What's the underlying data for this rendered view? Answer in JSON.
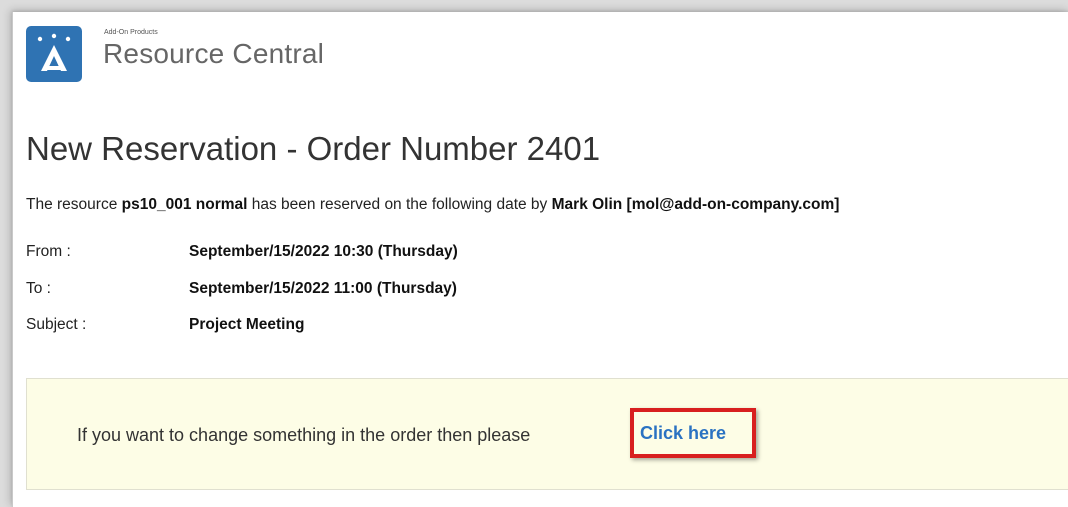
{
  "brand": {
    "small_text": "Add-On Products",
    "title": "Resource Central",
    "color": "#2f73b3"
  },
  "email": {
    "heading": "New Reservation - Order Number 2401",
    "sentence": {
      "prefix": "The resource ",
      "resource": "ps10_001 normal",
      "middle": " has been reserved on the following date by ",
      "person": "Mark Olin [mol@add-on-company.com]"
    },
    "details": [
      {
        "label": "From :",
        "value": "September/15/2022 10:30 (Thursday)"
      },
      {
        "label": "To :",
        "value": "September/15/2022 11:00 (Thursday)"
      },
      {
        "label": "Subject :",
        "value": "Project Meeting"
      }
    ],
    "change_prompt": "If you want to change something in the order then please",
    "link_text": "Click here"
  },
  "colors": {
    "link": "#2a72c2",
    "highlight": "#d81f1f",
    "banner": "#fdfde6"
  }
}
